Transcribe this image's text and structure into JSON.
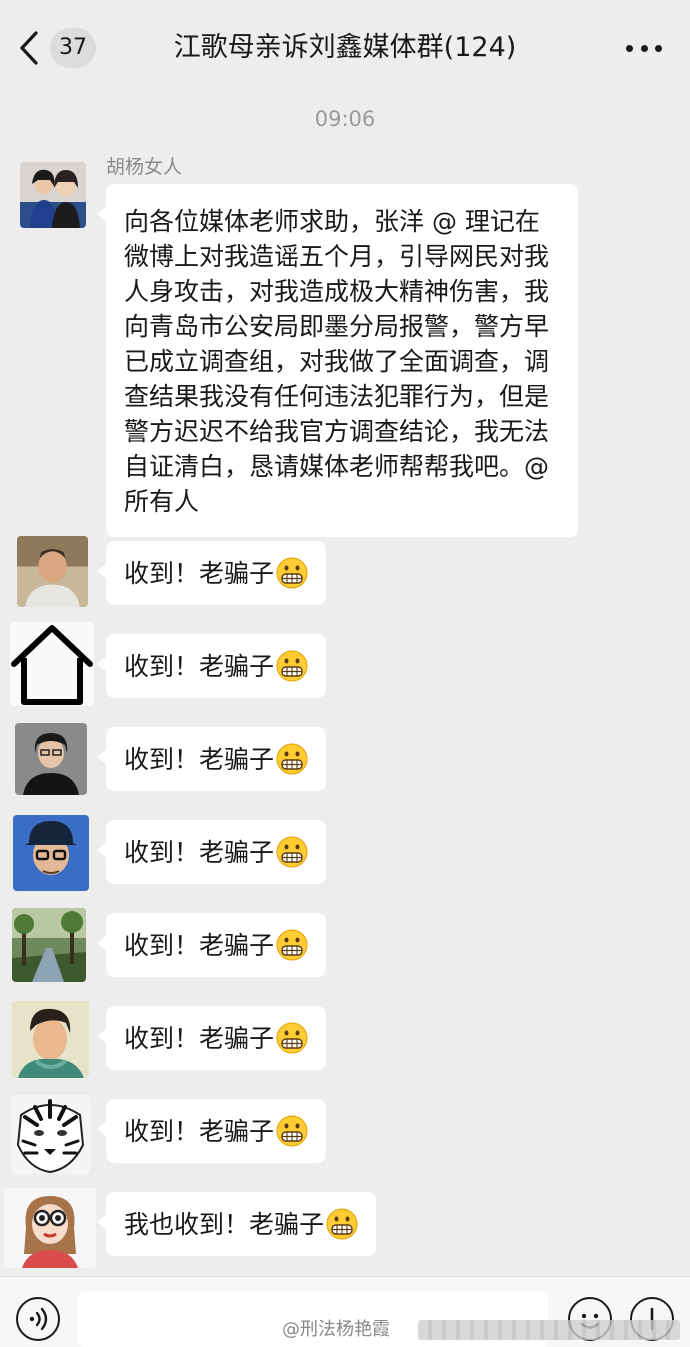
{
  "header": {
    "unread_count": "37",
    "title": "江歌母亲诉刘鑫媒体群(124)"
  },
  "timestamp": "09:06",
  "first_message": {
    "sender": "胡杨女人",
    "text": "向各位媒体老师求助，张洋 @ 理记在微博上对我造谣五个月，引导网民对我人身攻击，对我造成极大精神伤害，我向青岛市公安局即墨分局报警，警方早已成立调查组，对我做了全面调查，调查结果我没有任何违法犯罪行为，但是警方迟迟不给我官方调查结论，我无法自证清白，恳请媒体老师帮帮我吧。@ 所有人"
  },
  "replies": [
    {
      "text": "收到！老骗子",
      "emoji": "grimacing-emoji"
    },
    {
      "text": "收到！老骗子",
      "emoji": "grimacing-emoji"
    },
    {
      "text": "收到！老骗子",
      "emoji": "grimacing-emoji"
    },
    {
      "text": "收到！老骗子",
      "emoji": "grimacing-emoji"
    },
    {
      "text": "收到！老骗子",
      "emoji": "grimacing-emoji"
    },
    {
      "text": "收到！老骗子",
      "emoji": "grimacing-emoji"
    },
    {
      "text": "收到！老骗子",
      "emoji": "grimacing-emoji"
    },
    {
      "text": "我也收到！老骗子",
      "emoji": "grimacing-emoji"
    }
  ],
  "watermark": "@刑法杨艳霞",
  "colors": {
    "background": "#ededed",
    "bubble": "#ffffff",
    "text": "#191919",
    "muted": "#9a9a9a"
  }
}
